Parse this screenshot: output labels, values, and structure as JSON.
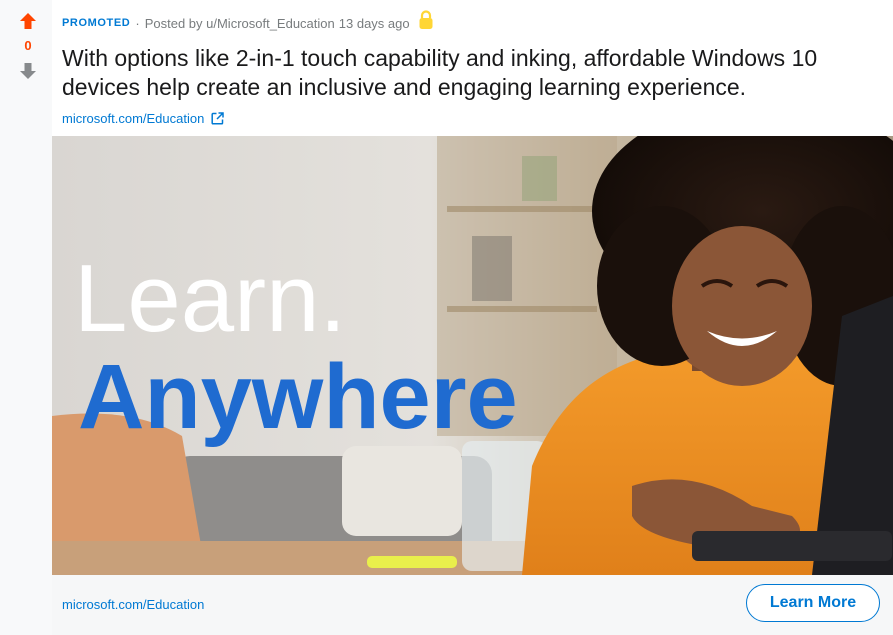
{
  "vote": {
    "count": "0"
  },
  "post": {
    "promoted_label": "PROMOTED",
    "separator": "·",
    "posted_by": "Posted by u/Microsoft_Education",
    "age": "13 days ago",
    "title": "With options like 2-in-1 touch capability and inking, affordable Windows 10 devices help create an inclusive and engaging learning experience.",
    "domain": "microsoft.com/Education"
  },
  "ad_image": {
    "line1": "Learn.",
    "line2": "Anywhere"
  },
  "footer": {
    "domain": "microsoft.com/Education",
    "cta_label": "Learn More"
  },
  "colors": {
    "upvote": "#ff4500",
    "link": "#0079d3",
    "image_headline_blue": "#1f6bd0",
    "lock": "#ffd635"
  },
  "icons": [
    "upvote-arrow-icon",
    "downvote-arrow-icon",
    "lock-icon",
    "external-link-icon"
  ]
}
